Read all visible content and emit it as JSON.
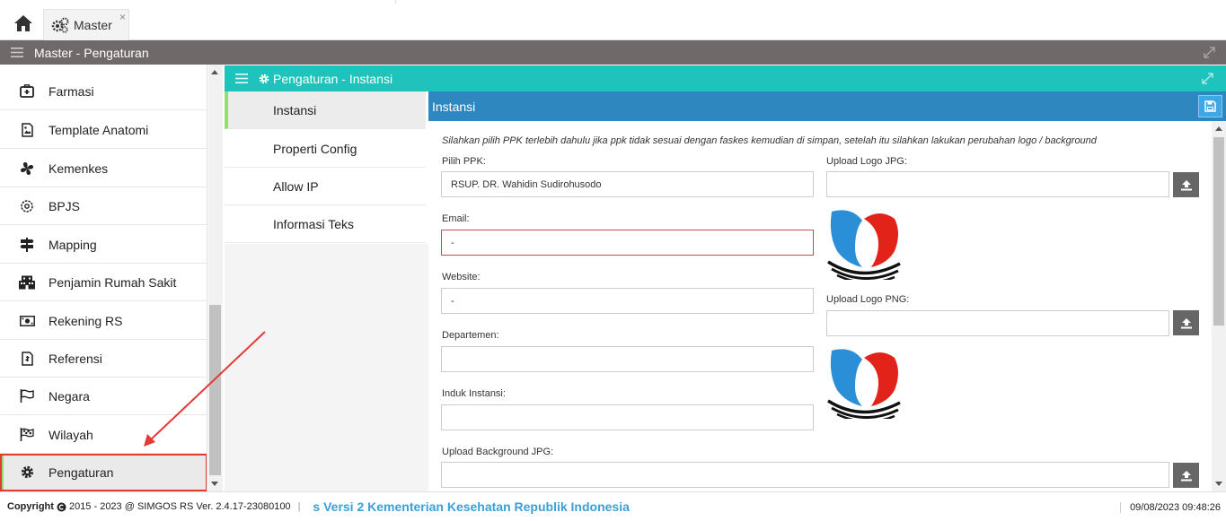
{
  "topbar": {
    "tab_label": "Master",
    "tab_close": "×"
  },
  "titlebar": {
    "title": "Master - Pengaturan"
  },
  "sidebar": {
    "items": [
      {
        "label": "Farmasi",
        "icon": "medical-kit-icon"
      },
      {
        "label": "Template Anatomi",
        "icon": "image-file-icon"
      },
      {
        "label": "Kemenkes",
        "icon": "fan-icon"
      },
      {
        "label": "BPJS",
        "icon": "settings-outline-icon"
      },
      {
        "label": "Mapping",
        "icon": "signpost-icon"
      },
      {
        "label": "Penjamin Rumah Sakit",
        "icon": "building-icon"
      },
      {
        "label": "Rekening RS",
        "icon": "money-icon"
      },
      {
        "label": "Referensi",
        "icon": "document-icon"
      },
      {
        "label": "Negara",
        "icon": "flag-outline-icon"
      },
      {
        "label": "Wilayah",
        "icon": "checkered-flag-icon"
      },
      {
        "label": "Pengaturan",
        "icon": "gear-icon"
      }
    ]
  },
  "panel": {
    "title": "Pengaturan - Instansi"
  },
  "subnav": {
    "items": [
      {
        "label": "Instansi"
      },
      {
        "label": "Properti Config"
      },
      {
        "label": "Allow IP"
      },
      {
        "label": "Informasi Teks"
      }
    ]
  },
  "content": {
    "title": "Instansi",
    "note": "Silahkan pilih PPK terlebih dahulu jika ppk tidak sesuai dengan faskes kemudian di simpan, setelah itu silahkan lakukan perubahan logo / background",
    "ppk_label": "Pilih PPK:",
    "ppk_value": "RSUP. DR. Wahidin Sudirohusodo",
    "email_label": "Email:",
    "email_value": "-",
    "website_label": "Website:",
    "website_value": "-",
    "departemen_label": "Departemen:",
    "departemen_value": "",
    "induk_label": "Induk Instansi:",
    "induk_value": "",
    "logo_jpg_label": "Upload Logo JPG:",
    "logo_png_label": "Upload Logo PNG:",
    "bg_jpg_label": "Upload Background JPG:"
  },
  "footer": {
    "copyright_label": "Copyright",
    "copyright_text": "2015 - 2023 @ SIMGOS RS Ver. 2.4.17-23080100",
    "separator": "|",
    "marquee": "s Versi 2 Kementerian Kesehatan Republik Indonesia",
    "datetime": "09/08/2023 09:48:26"
  },
  "colors": {
    "titlebar": "#6f6969",
    "panel_head": "#1fc3bc",
    "content_head": "#2f87c0",
    "active_accent": "#90e06b",
    "highlight": "#e53935"
  }
}
